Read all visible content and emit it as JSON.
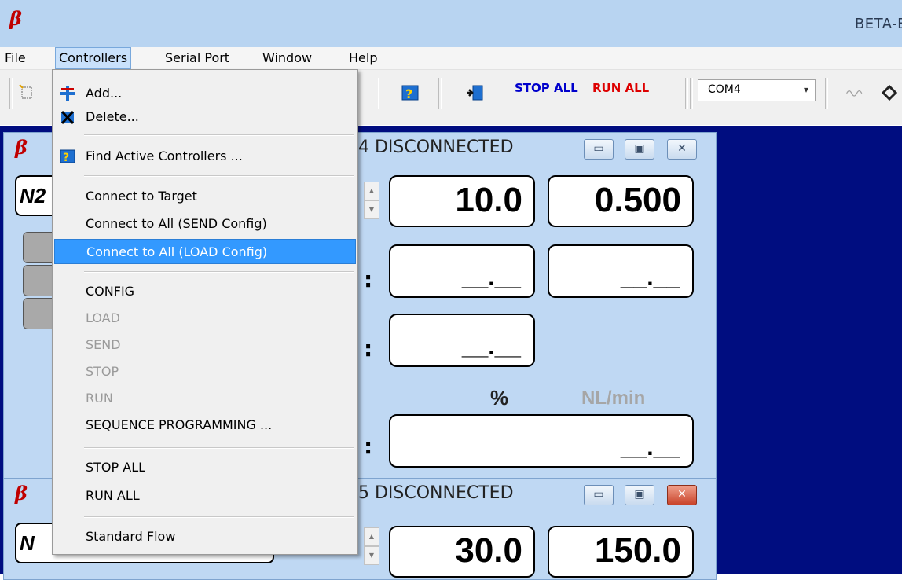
{
  "window": {
    "logo": "β",
    "title": "BETA-E"
  },
  "menubar": {
    "items": [
      "File",
      "Controllers",
      "Serial Port",
      "Window",
      "Help"
    ]
  },
  "toolbar": {
    "stop_all": "STOP ALL",
    "run_all": "RUN ALL",
    "com_port": "COM4"
  },
  "controllers_menu": {
    "items": [
      {
        "label": "Add...",
        "icon": "add-icon",
        "enabled": true
      },
      {
        "label": "Delete...",
        "icon": "delete-icon",
        "enabled": true
      },
      {
        "label": "Find Active Controllers ...",
        "icon": "find-icon",
        "enabled": true
      },
      {
        "label": "Connect to Target",
        "enabled": true
      },
      {
        "label": "Connect to All (SEND Config)",
        "enabled": true
      },
      {
        "label": "Connect to All (LOAD Config)",
        "enabled": true,
        "highlighted": true
      },
      {
        "label": "CONFIG",
        "enabled": true
      },
      {
        "label": "LOAD",
        "enabled": false
      },
      {
        "label": "SEND",
        "enabled": false
      },
      {
        "label": "STOP",
        "enabled": false
      },
      {
        "label": "RUN",
        "enabled": false
      },
      {
        "label": "SEQUENCE PROGRAMMING ...",
        "enabled": true
      },
      {
        "label": "STOP ALL",
        "enabled": true
      },
      {
        "label": "RUN ALL",
        "enabled": true
      },
      {
        "label": "Standard Flow",
        "enabled": true
      }
    ]
  },
  "controller_windows": [
    {
      "status": "4 DISCONNECTED",
      "name": "N2",
      "setpoint": "10.0",
      "range": "0.500",
      "reading_1a": "__.__",
      "reading_1b": "__.__",
      "reading_2": "__.__",
      "total": "__.__",
      "unit_percent": "%",
      "unit_flow": "NL/min"
    },
    {
      "status": "5 DISCONNECTED",
      "name": "N",
      "setpoint": "30.0",
      "range": "150.0"
    }
  ]
}
